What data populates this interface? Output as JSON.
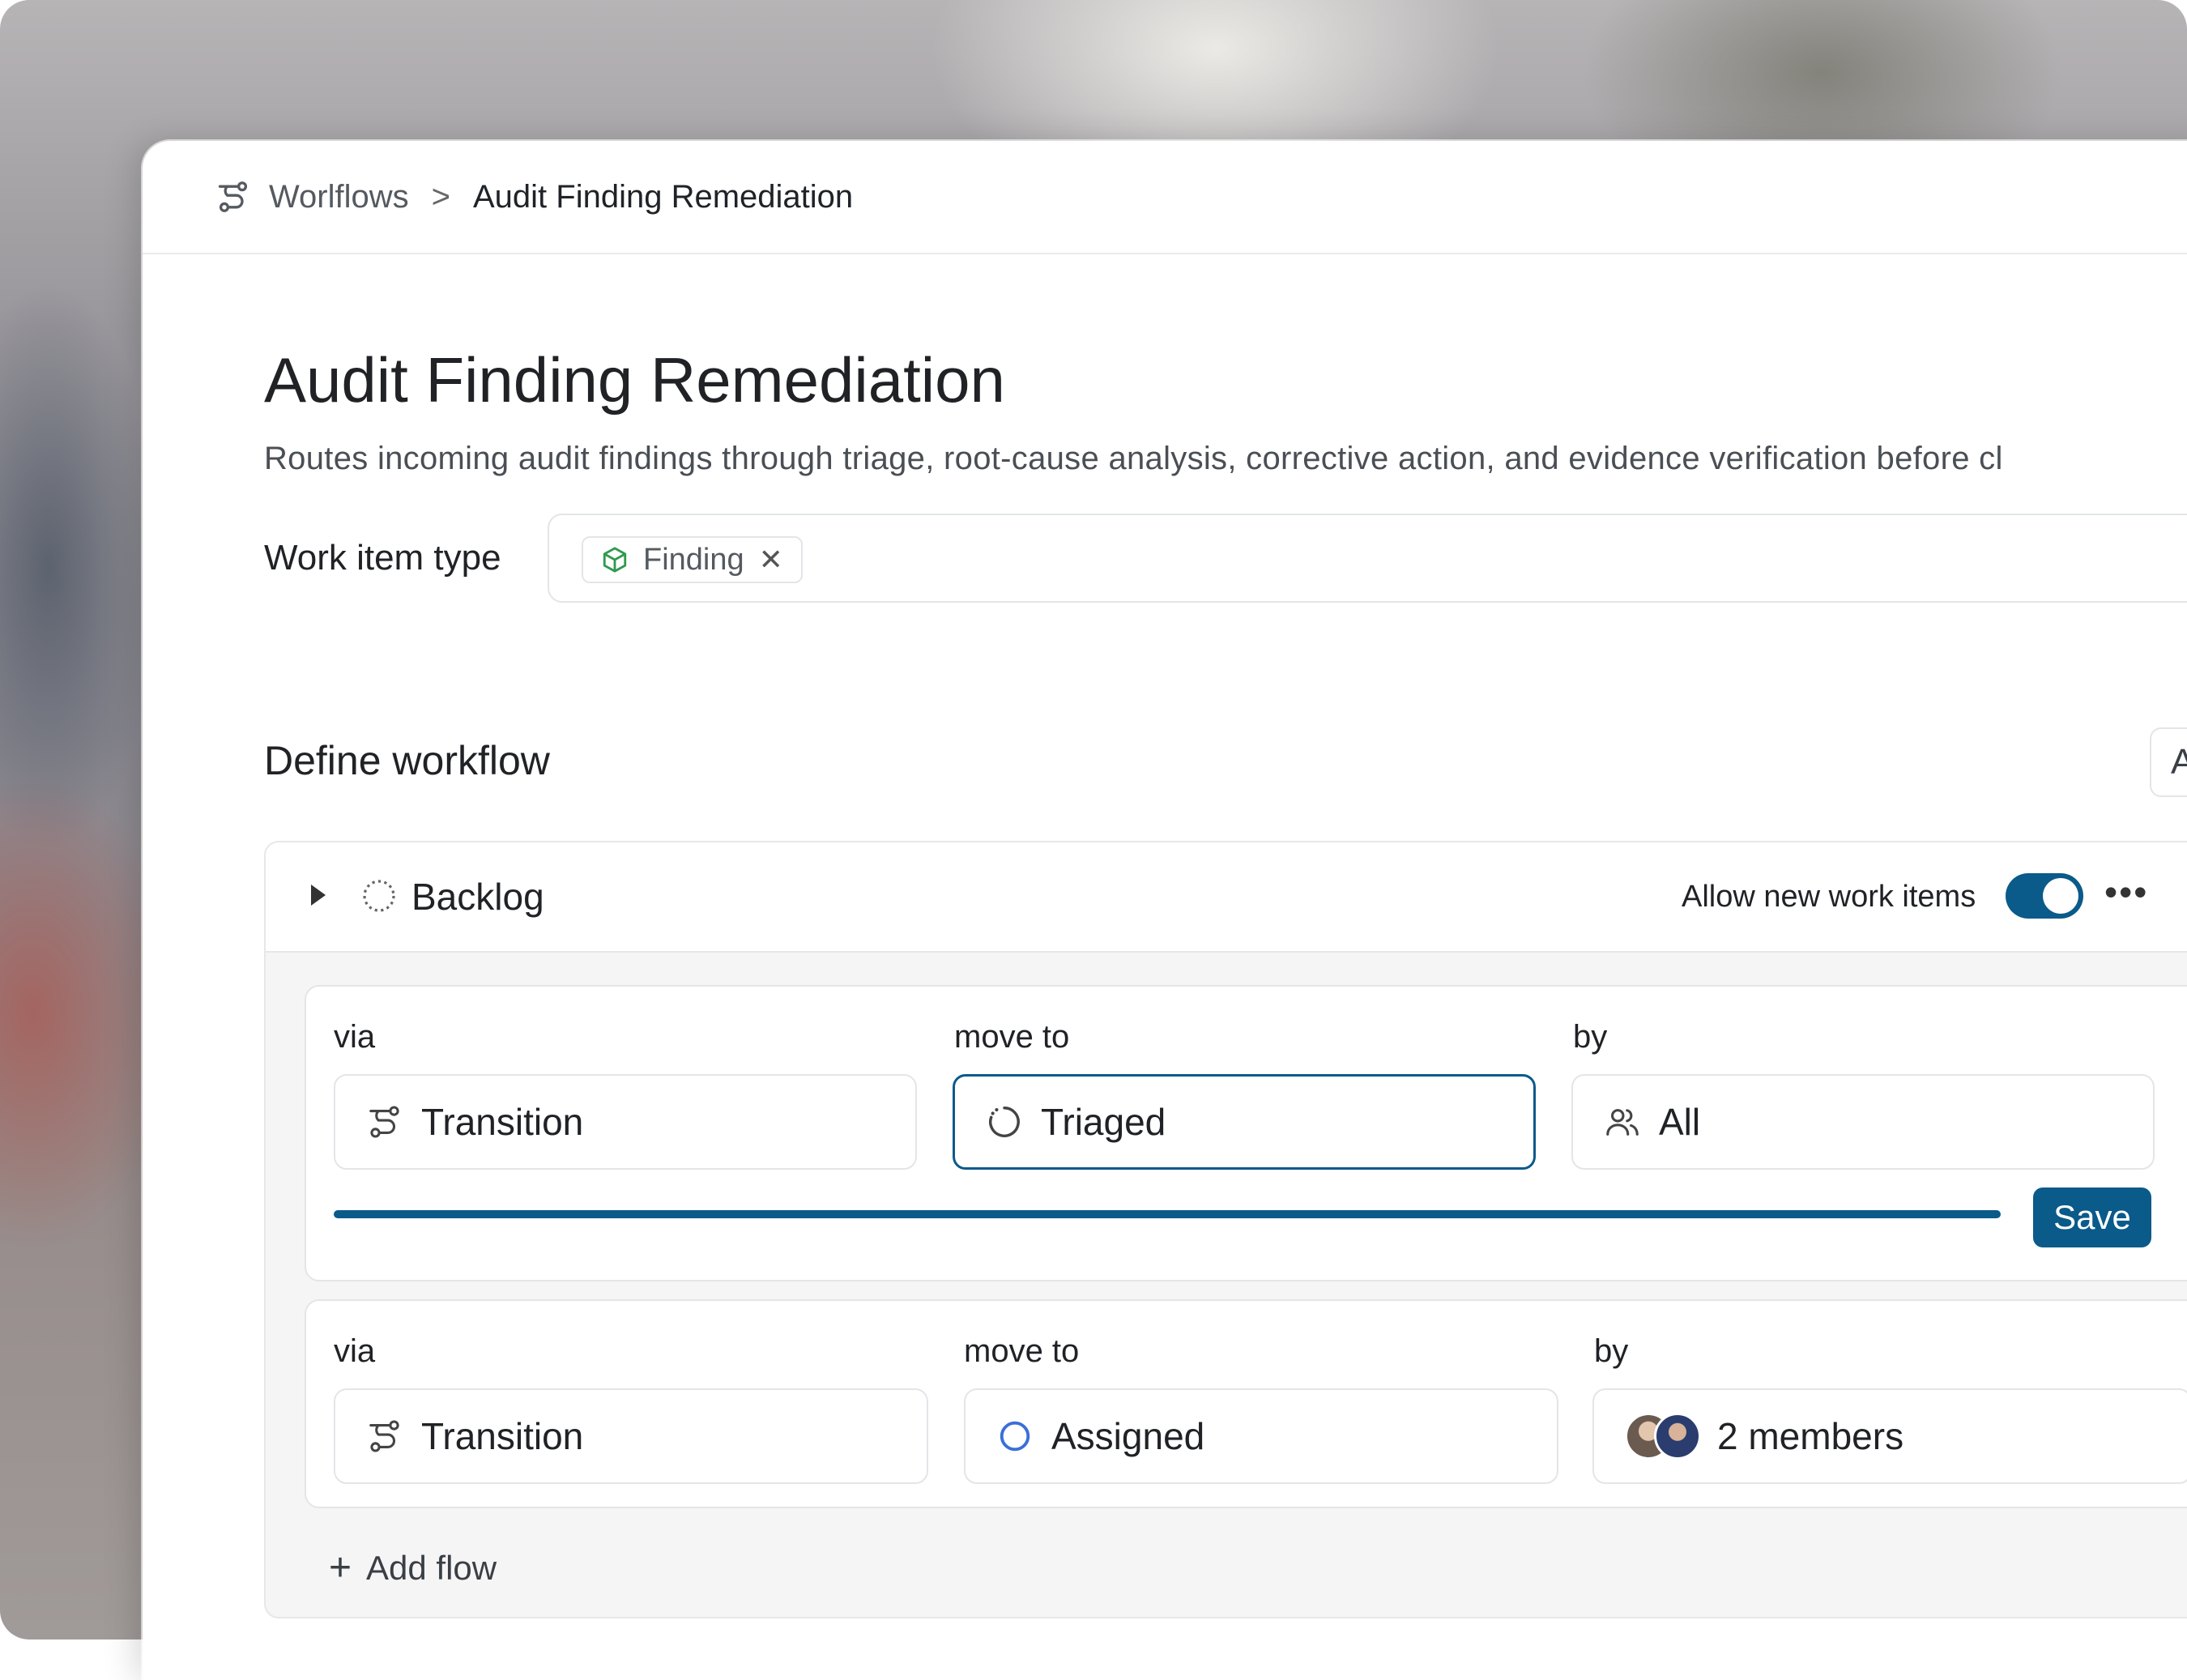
{
  "breadcrumb": {
    "root_icon": "workflow-icon",
    "root_label": "Worlflows",
    "separator": ">",
    "current": "Audit Finding Remediation"
  },
  "header": {
    "title": "Audit Finding Remediation",
    "description": "Routes incoming audit findings through triage, root-cause analysis, corrective action, and evidence verification before cl"
  },
  "work_item_type": {
    "label": "Work item type",
    "chip_icon": "cube-icon",
    "chip_label": "Finding",
    "chip_remove": "✕"
  },
  "workflow": {
    "title": "Define workflow",
    "add_state_label": "Add stat",
    "state": {
      "name": "Backlog",
      "icon": "dashed-circle-icon",
      "allow_label": "Allow new work items",
      "allow_enabled": true,
      "more": "•••"
    },
    "flows": [
      {
        "via_label": "via",
        "move_label": "move to",
        "by_label": "by",
        "via_value": "Transition",
        "move_value": "Triaged",
        "by_value": "All",
        "progress": 1.0,
        "save_label": "Save"
      },
      {
        "via_label": "via",
        "move_label": "move to",
        "by_label": "by",
        "via_value": "Transition",
        "move_value": "Assigned",
        "by_value": "2 members"
      }
    ],
    "add_flow_label": "Add flow",
    "add_flow_icon": "+"
  },
  "colors": {
    "accent": "#0a5a8a",
    "chip_icon": "#2f9a4e",
    "assigned_ring": "#3b6fd8"
  }
}
